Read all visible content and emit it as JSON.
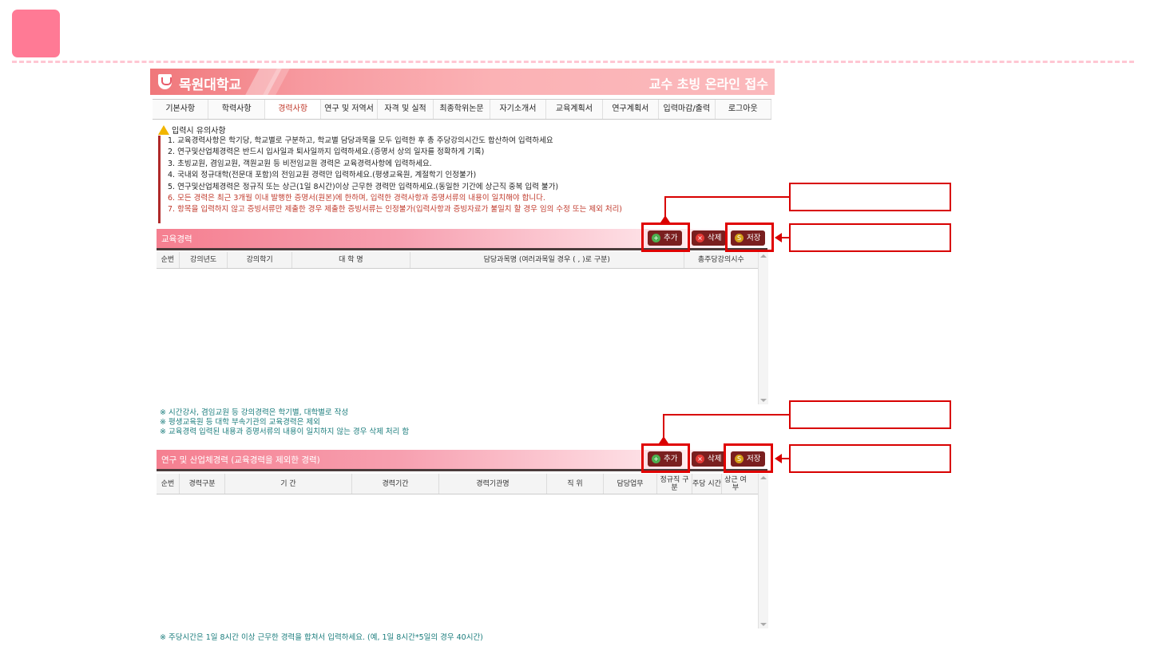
{
  "header": {
    "university": "목원대학교",
    "title": "교수 초빙 온라인 접수"
  },
  "tabs": [
    {
      "label": "기본사항"
    },
    {
      "label": "학력사항"
    },
    {
      "label": "경력사항",
      "active": true
    },
    {
      "label": "연구 및 저역서"
    },
    {
      "label": "자격 및 실적"
    },
    {
      "label": "최종학위논문"
    },
    {
      "label": "자기소개서"
    },
    {
      "label": "교육계획서"
    },
    {
      "label": "연구계획서"
    },
    {
      "label": "입력마감/출력"
    },
    {
      "label": "로그아웃"
    }
  ],
  "notice": {
    "heading": "입력시 유의사항",
    "items": [
      "1. 교육경력사항은 학기당, 학교별로 구분하고, 학교별 담당과목을 모두 입력한 후 총 주당강의시간도 합산하여 입력하세요",
      "2. 연구및산업체경력은 반드시 입사일과 퇴사일까지 입력하세요.(증명서 상의 일자를 정확하게 기록)",
      "3. 초빙교원, 겸임교원, 객원교원 등 비전임교원 경력은 교육경력사항에 입력하세요.",
      "4. 국내외 정규대학(전문대 포함)의 전임교원 경력만 입력하세요.(평생교육원, 계절학기 인정불가)",
      "5. 연구및산업체경력은 정규직 또는 상근(1일 8시간)이상 근무한 경력만 입력하세요.(동일한 기간에 상근직 중복 입력 불가)",
      "6. 모든 경력은 최근 3개월 이내 발행한 증명서(원본)에 한하며, 입력한 경력사항과 증명서류의 내용이 일치해야 합니다.",
      "7. 항목을 입력하지 않고 증빙서류만 제출한 경우 제출한 증빙서류는 인정불가(입력사항과 증빙자료가 불일치 할 경우 임의 수정 또는 제외 처리)"
    ]
  },
  "buttons": {
    "add": "추가",
    "delete": "삭제",
    "save": "저장"
  },
  "section1": {
    "title": "교육경력",
    "columns": [
      "순번",
      "강의년도",
      "강의학기",
      "대 학 명",
      "담당과목명 (여러과목일 경우 ( , )로 구분)",
      "총주당강의시수"
    ],
    "notes": [
      "※ 시간강사, 겸임교원 등 강의경력은 학기별, 대학별로 작성",
      "※ 평생교육원 등 대학 부속기관의 교육경력은 제외",
      "※ 교육경력 입력된 내용과 증명서류의 내용이 일치하지 않는 경우 삭제 처리 함"
    ]
  },
  "section2": {
    "title": "연구 및 산업체경력 (교육경력을 제외한 경력)",
    "columns": [
      "순번",
      "경력구분",
      "기 간",
      "경력기간",
      "경력기관명",
      "직 위",
      "담당업무",
      "정규직 구 분",
      "주당 시간",
      "상근 여부"
    ],
    "notes": [
      "※ 주당시간은 1일 8시간 이상 근무한 경력을 합쳐서 입력하세요. (예, 1일 8시간*5일의 경우 40시간)"
    ]
  },
  "colors": {
    "accent": "#f57f90",
    "highlight": "#e00000",
    "button": "#7a1f1f"
  }
}
